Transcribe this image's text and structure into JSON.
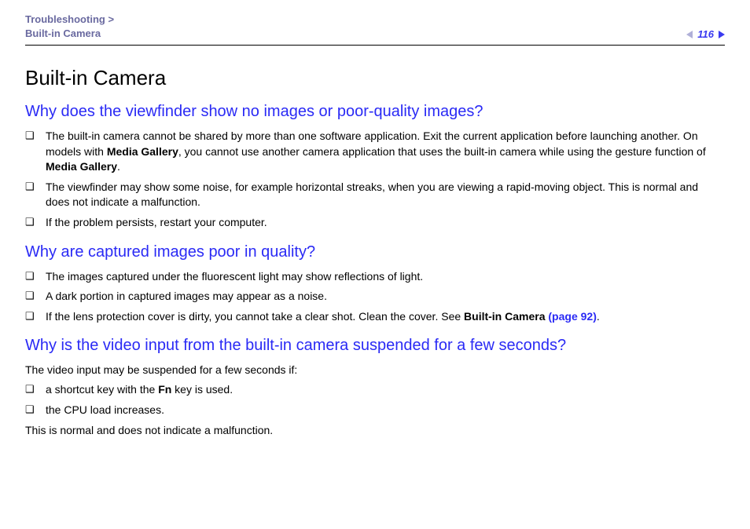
{
  "header": {
    "breadcrumb_parent": "Troubleshooting",
    "breadcrumb_sep": ">",
    "breadcrumb_current": "Built-in Camera",
    "page_number": "116"
  },
  "title": "Built-in Camera",
  "sections": [
    {
      "heading": "Why does the viewfinder show no images or poor-quality images?",
      "intro": null,
      "items": [
        {
          "pre": "The built-in camera cannot be shared by more than one software application. Exit the current application before launching another. On models with ",
          "bold1": "Media Gallery",
          "mid": ", you cannot use another camera application that uses the built-in camera while using the gesture function of ",
          "bold2": "Media Gallery",
          "post": "."
        },
        {
          "pre": "The viewfinder may show some noise, for example horizontal streaks, when you are viewing a rapid-moving object. This is normal and does not indicate a malfunction.",
          "bold1": null,
          "mid": null,
          "bold2": null,
          "post": null
        },
        {
          "pre": "If the problem persists, restart your computer.",
          "bold1": null,
          "mid": null,
          "bold2": null,
          "post": null
        }
      ],
      "outro": null
    },
    {
      "heading": "Why are captured images poor in quality?",
      "intro": null,
      "items": [
        {
          "pre": "The images captured under the fluorescent light may show reflections of light.",
          "bold1": null,
          "mid": null,
          "bold2": null,
          "post": null
        },
        {
          "pre": "A dark portion in captured images may appear as a noise.",
          "bold1": null,
          "mid": null,
          "bold2": null,
          "post": null
        },
        {
          "pre": "If the lens protection cover is dirty, you cannot take a clear shot. Clean the cover. See ",
          "bold1": "Built-in Camera ",
          "link": "(page 92)",
          "post": "."
        }
      ],
      "outro": null
    },
    {
      "heading": "Why is the video input from the built-in camera suspended for a few seconds?",
      "intro": "The video input may be suspended for a few seconds if:",
      "items": [
        {
          "pre": "a shortcut key with the ",
          "bold1": "Fn",
          "mid": " key is used.",
          "bold2": null,
          "post": null
        },
        {
          "pre": "the CPU load increases.",
          "bold1": null,
          "mid": null,
          "bold2": null,
          "post": null
        }
      ],
      "outro": "This is normal and does not indicate a malfunction."
    }
  ]
}
